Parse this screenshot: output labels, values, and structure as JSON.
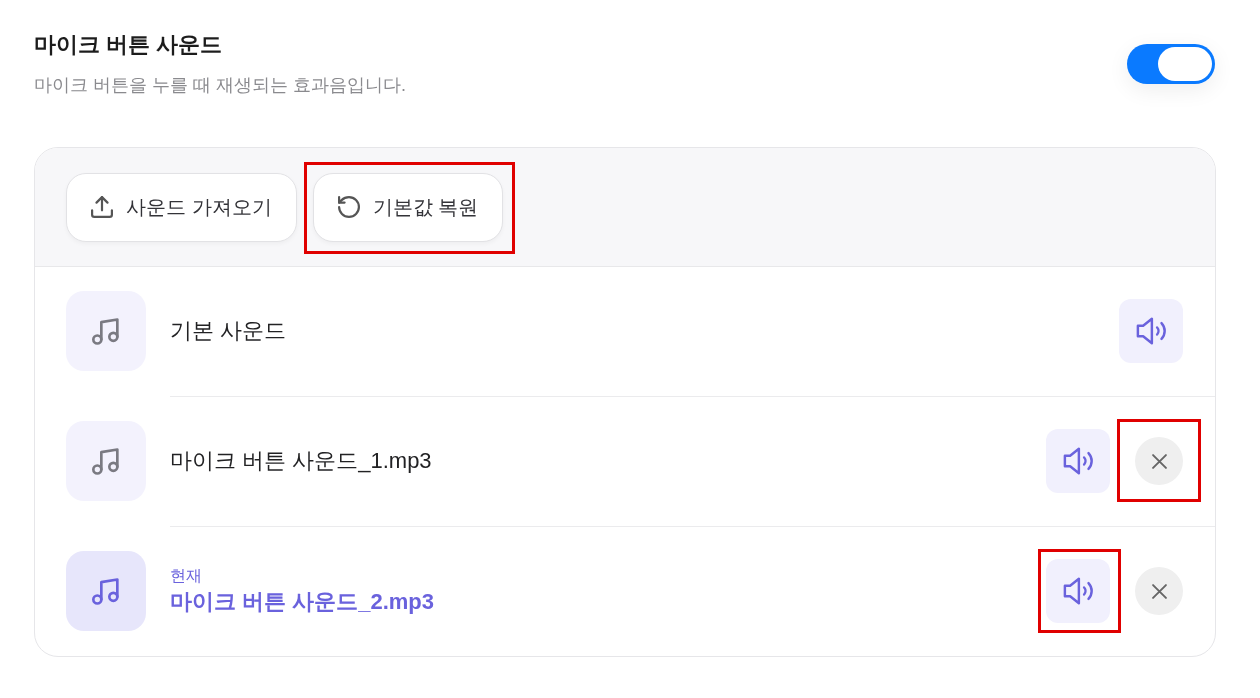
{
  "setting": {
    "title": "마이크 버튼 사운드",
    "description": "마이크 버튼을 누를 때 재생되는 효과음입니다.",
    "toggle": {
      "on": true
    }
  },
  "toolbar": {
    "buttons": [
      {
        "kind": "import",
        "label": "사운드 가져오기",
        "highlighted": false
      },
      {
        "kind": "restore",
        "label": "기본값 복원",
        "highlighted": true
      }
    ]
  },
  "sounds": [
    {
      "name": "기본 사운드",
      "selected": false,
      "removable": false,
      "preview_highlighted": false
    },
    {
      "name": "마이크 버튼 사운드_1.mp3",
      "selected": false,
      "removable": true,
      "preview_highlighted": false,
      "remove_highlighted": true
    },
    {
      "current_label": "현재",
      "name": "마이크 버튼 사운드_2.mp3",
      "selected": true,
      "removable": true,
      "preview_highlighted": true,
      "remove_highlighted": false
    }
  ]
}
